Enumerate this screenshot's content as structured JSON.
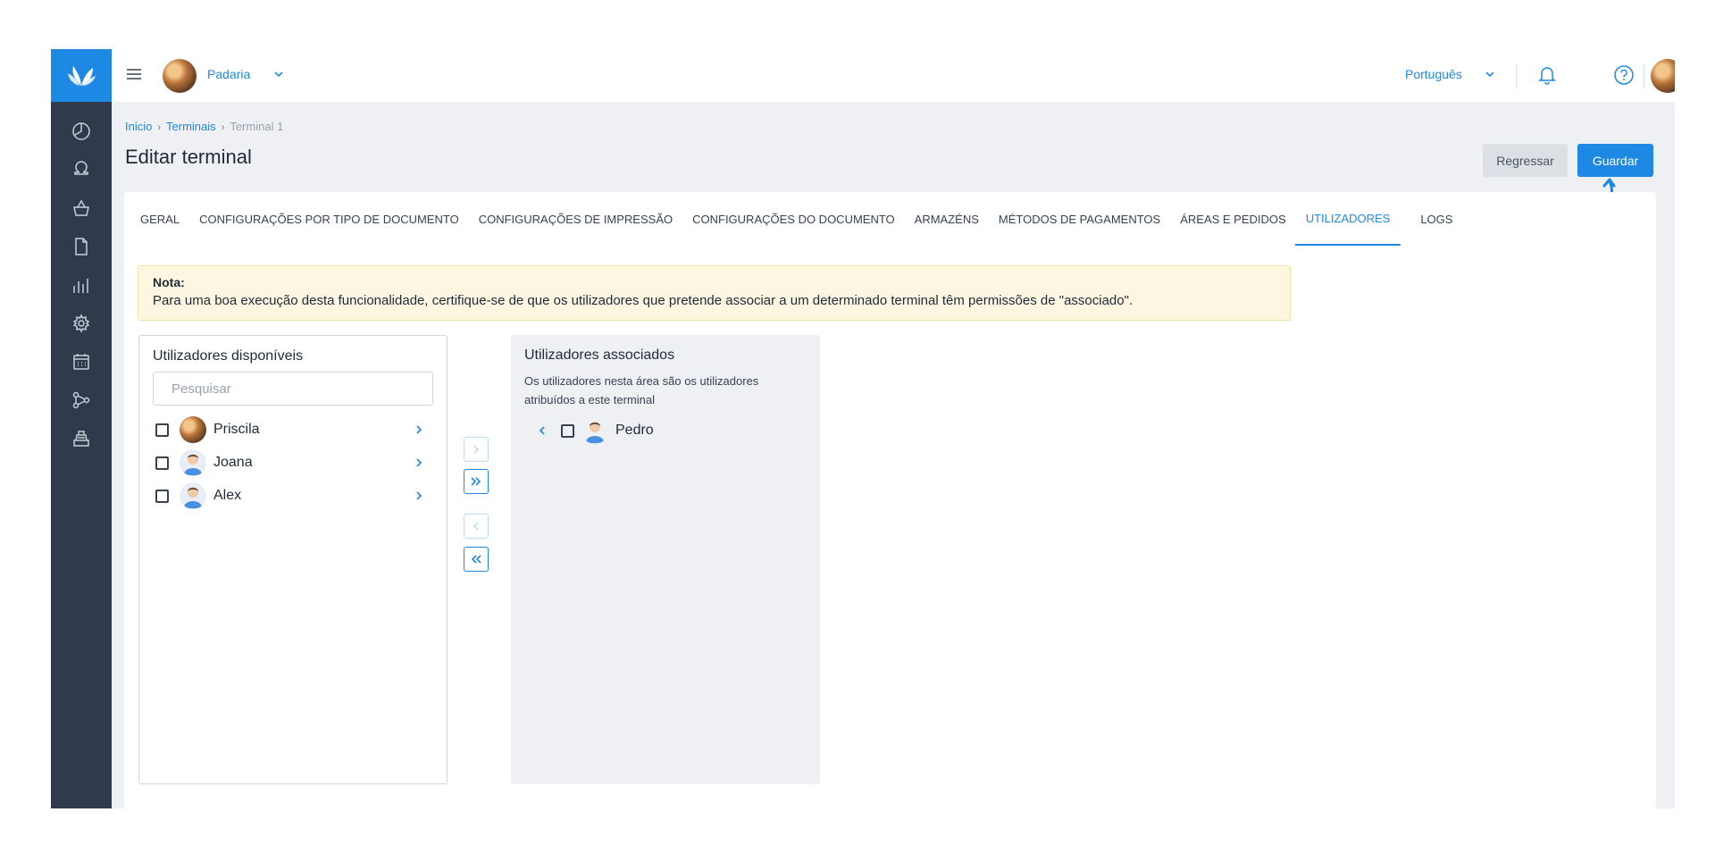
{
  "topbar": {
    "company_name": "Padaria",
    "language": "Português"
  },
  "breadcrumb": {
    "home": "Inicio",
    "section": "Terminais",
    "current": "Terminal 1"
  },
  "page": {
    "title": "Editar terminal",
    "back_label": "Regressar",
    "save_label": "Guardar"
  },
  "tabs": [
    {
      "label": "GERAL"
    },
    {
      "label": "CONFIGURAÇÕES POR TIPO DE DOCUMENTO"
    },
    {
      "label": "CONFIGURAÇÕES DE IMPRESSÃO"
    },
    {
      "label": "CONFIGURAÇÕES DO DOCUMENTO"
    },
    {
      "label": "ARMAZÉNS"
    },
    {
      "label": "MÉTODOS DE PAGAMENTOS"
    },
    {
      "label": "ÁREAS E PEDIDOS"
    },
    {
      "label": "UTILIZADORES"
    },
    {
      "label": "LOGS"
    }
  ],
  "active_tab": "UTILIZADORES",
  "note": {
    "title": "Nota:",
    "text": "Para uma boa execução desta funcionalidade, certifique-se de que os utilizadores que pretende associar a um determinado terminal têm permissões de \"associado\"."
  },
  "available": {
    "title": "Utilizadores disponíveis",
    "search_placeholder": "Pesquisar",
    "users": [
      {
        "name": "Priscila",
        "avatar": "photo"
      },
      {
        "name": "Joana",
        "avatar": "person-icon"
      },
      {
        "name": "Alex",
        "avatar": "person-icon"
      }
    ]
  },
  "associated": {
    "title": "Utilizadores associados",
    "description": "Os utilizadores nesta área são os utilizadores atribuídos a este terminal",
    "users": [
      {
        "name": "Pedro",
        "avatar": "person-icon"
      }
    ]
  },
  "colors": {
    "primary": "#1e88e5",
    "sidebar": "#2f3a4c",
    "note_bg": "#fdf6e1"
  }
}
